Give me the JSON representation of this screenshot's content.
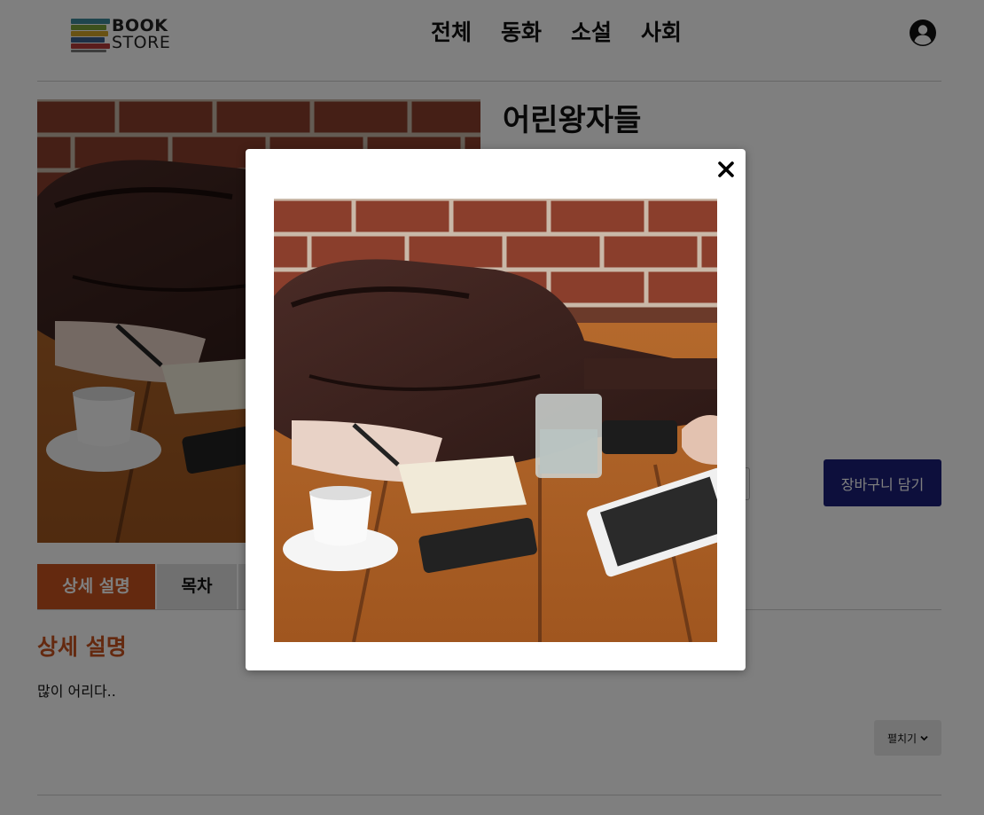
{
  "header": {
    "logo": {
      "line1": "BOOK",
      "line2": "STORE"
    },
    "nav": [
      "전체",
      "동화",
      "소설",
      "사회"
    ],
    "user_icon": "user-circle-icon"
  },
  "product": {
    "title": "어린왕자들",
    "image_alt": "photo",
    "cart_button_label": "장바구니 담기",
    "quantity_value": ""
  },
  "tabs": {
    "items": [
      "상세 설명",
      "목차",
      ""
    ],
    "active_index": 0
  },
  "detail": {
    "heading": "상세 설명",
    "body": "많이 어리다..",
    "expand_label": "펼치기",
    "expand_icon": "chevron-down-icon"
  },
  "modal": {
    "close_icon": "close-icon",
    "image_alt": "photo"
  },
  "colors": {
    "accent": "#c8531f",
    "cart_button": "#1b1f78",
    "overlay": "rgba(0,0,0,0.5)"
  }
}
